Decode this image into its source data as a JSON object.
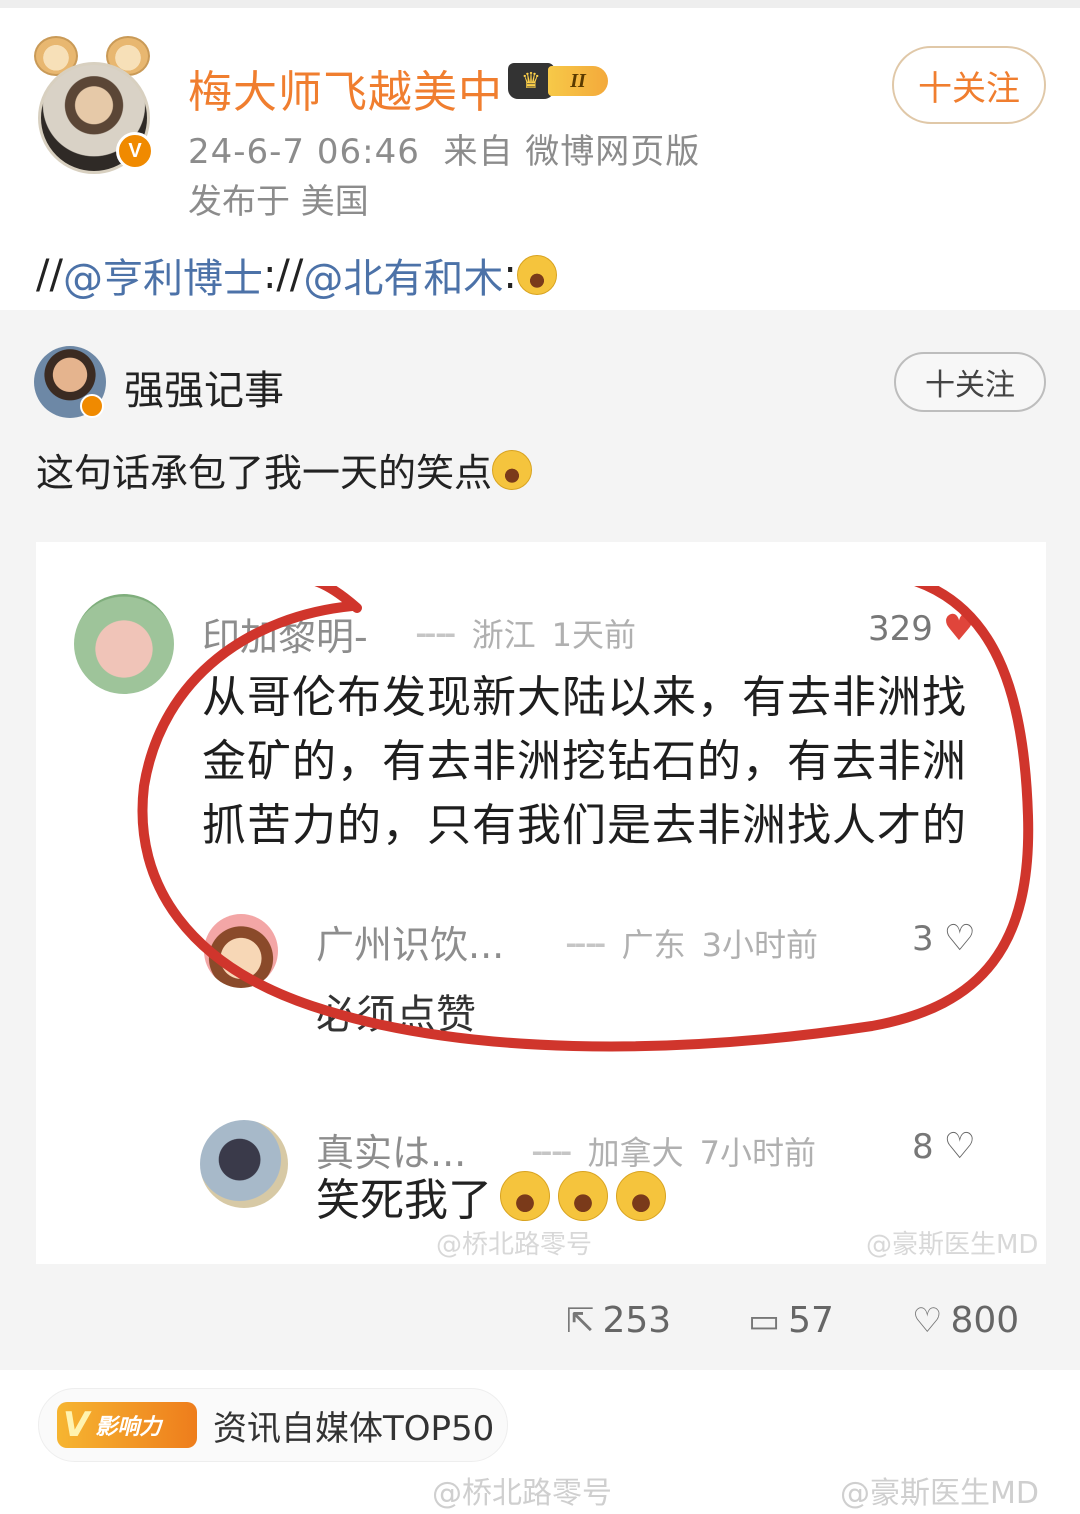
{
  "post": {
    "author_name": "梅大师飞越美中",
    "vip_level": "II",
    "meta": "24-6-7 06:46  来自 微博网页版",
    "location": "发布于 美国",
    "follow_label": "十关注",
    "repost_prefix": "//",
    "mention1": "@亨利博士",
    "separator": "://",
    "mention2": "@北有和木",
    "suffix": ":"
  },
  "quoted": {
    "author_name": "强强记事",
    "follow_label": "十关注",
    "text": "这句话承包了我一天的笑点",
    "screenshot": {
      "comments": [
        {
          "user": "印加黎明-",
          "location": "浙江",
          "time": "1天前",
          "likes": "329",
          "body": "从哥伦布发现新大陆以来，有去非洲找金矿的，有去非洲挖钻石的，有去非洲抓苦力的，只有我们是去非洲找人才的"
        },
        {
          "user": "广州识饮...",
          "location": "广东",
          "time": "3小时前",
          "likes": "3",
          "body": "必须点赞"
        },
        {
          "user": "真实は...",
          "location": "加拿大",
          "time": "7小时前",
          "likes": "8",
          "body": "笑死我了"
        }
      ],
      "watermark_left": "@桥北路零号",
      "watermark_right": "@豪斯医生MD"
    },
    "actions": {
      "repost_count": "253",
      "comment_count": "57",
      "like_count": "800"
    }
  },
  "bottom_tag": {
    "badge": "影响力",
    "text": "资讯自媒体TOP50"
  },
  "watermarks": {
    "left": "@桥北路零号",
    "right": "@豪斯医生MD"
  },
  "colors": {
    "author_orange": "#f07e2f",
    "mention_blue": "#4c72a8",
    "marker_red": "#d0352c",
    "heart_red": "#e0453b"
  },
  "icons": [
    "v-verified-icon",
    "vip-crown-icon",
    "laugh-emoji-icon",
    "heart-icon",
    "repost-icon",
    "comment-icon",
    "like-icon",
    "weibo-logo-icon"
  ]
}
